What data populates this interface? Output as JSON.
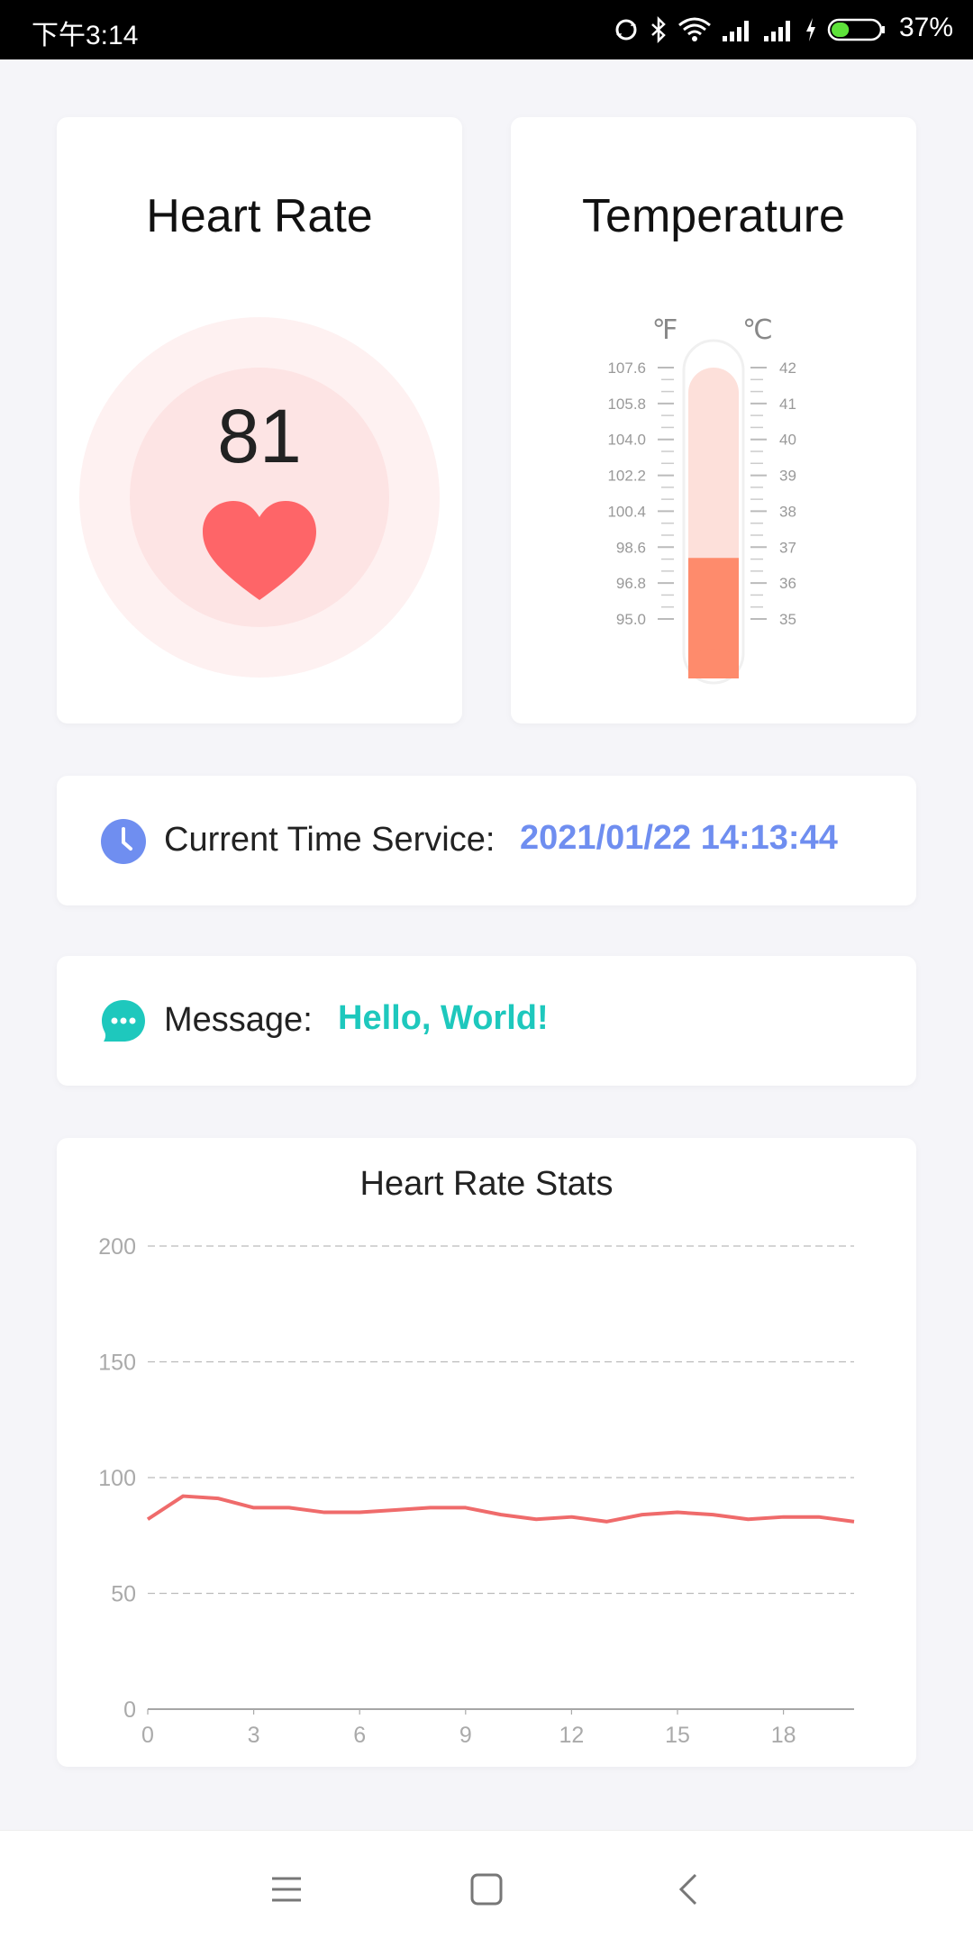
{
  "status_bar": {
    "time": "下午3:14",
    "battery_percent": "37%",
    "battery_level": 0.37,
    "icons": [
      "sync-icon",
      "bluetooth-icon",
      "wifi-icon",
      "signal-icon",
      "signal-icon",
      "charging-icon",
      "battery-icon"
    ]
  },
  "heart_rate": {
    "title": "Heart Rate",
    "value": "81",
    "colors": {
      "outer_ring": "#fef1f1",
      "inner_ring": "#fde4e4",
      "heart": "#fe6568"
    }
  },
  "temperature": {
    "title": "Temperature",
    "fahrenheit_unit": "℉",
    "celsius_unit": "℃",
    "fahrenheit_ticks": [
      "107.6",
      "105.8",
      "104.0",
      "102.2",
      "100.4",
      "98.6",
      "96.8",
      "95.0"
    ],
    "celsius_ticks": [
      "42",
      "41",
      "40",
      "39",
      "38",
      "37",
      "36",
      "35"
    ],
    "celsius_min": 35,
    "celsius_max": 42,
    "current_celsius": 36.7,
    "colors": {
      "fill": "#fe8b6c",
      "tube": "#fde0da"
    }
  },
  "time_service": {
    "label": "Current Time Service:",
    "value": "2021/01/22 14:13:44",
    "icon": "clock-icon",
    "accent": "#6f8ef0"
  },
  "message": {
    "label": "Message:",
    "value": "Hello, World!",
    "icon": "chat-bubble-icon",
    "accent": "#1ec8bd"
  },
  "chart_data": {
    "type": "line",
    "title": "Heart Rate Stats",
    "xlabel": "",
    "ylabel": "",
    "x": [
      0,
      1,
      2,
      3,
      4,
      5,
      6,
      7,
      8,
      9,
      10,
      11,
      12,
      13,
      14,
      15,
      16,
      17,
      18,
      19,
      20
    ],
    "series": [
      {
        "values": [
          82,
          92,
          91,
          87,
          87,
          85,
          85,
          86,
          87,
          87,
          84,
          82,
          83,
          81,
          84,
          85,
          84,
          82,
          83,
          83,
          81
        ],
        "color": "#ef6b6b"
      }
    ],
    "xticks": [
      "0",
      "3",
      "6",
      "9",
      "12",
      "15",
      "18"
    ],
    "yticks": [
      "0",
      "50",
      "100",
      "150",
      "200"
    ],
    "xlim": [
      0,
      20
    ],
    "ylim": [
      0,
      200
    ],
    "grid": true
  },
  "nav_bar": {
    "icons": [
      "menu-icon",
      "home-square-icon",
      "back-chevron-icon"
    ]
  }
}
